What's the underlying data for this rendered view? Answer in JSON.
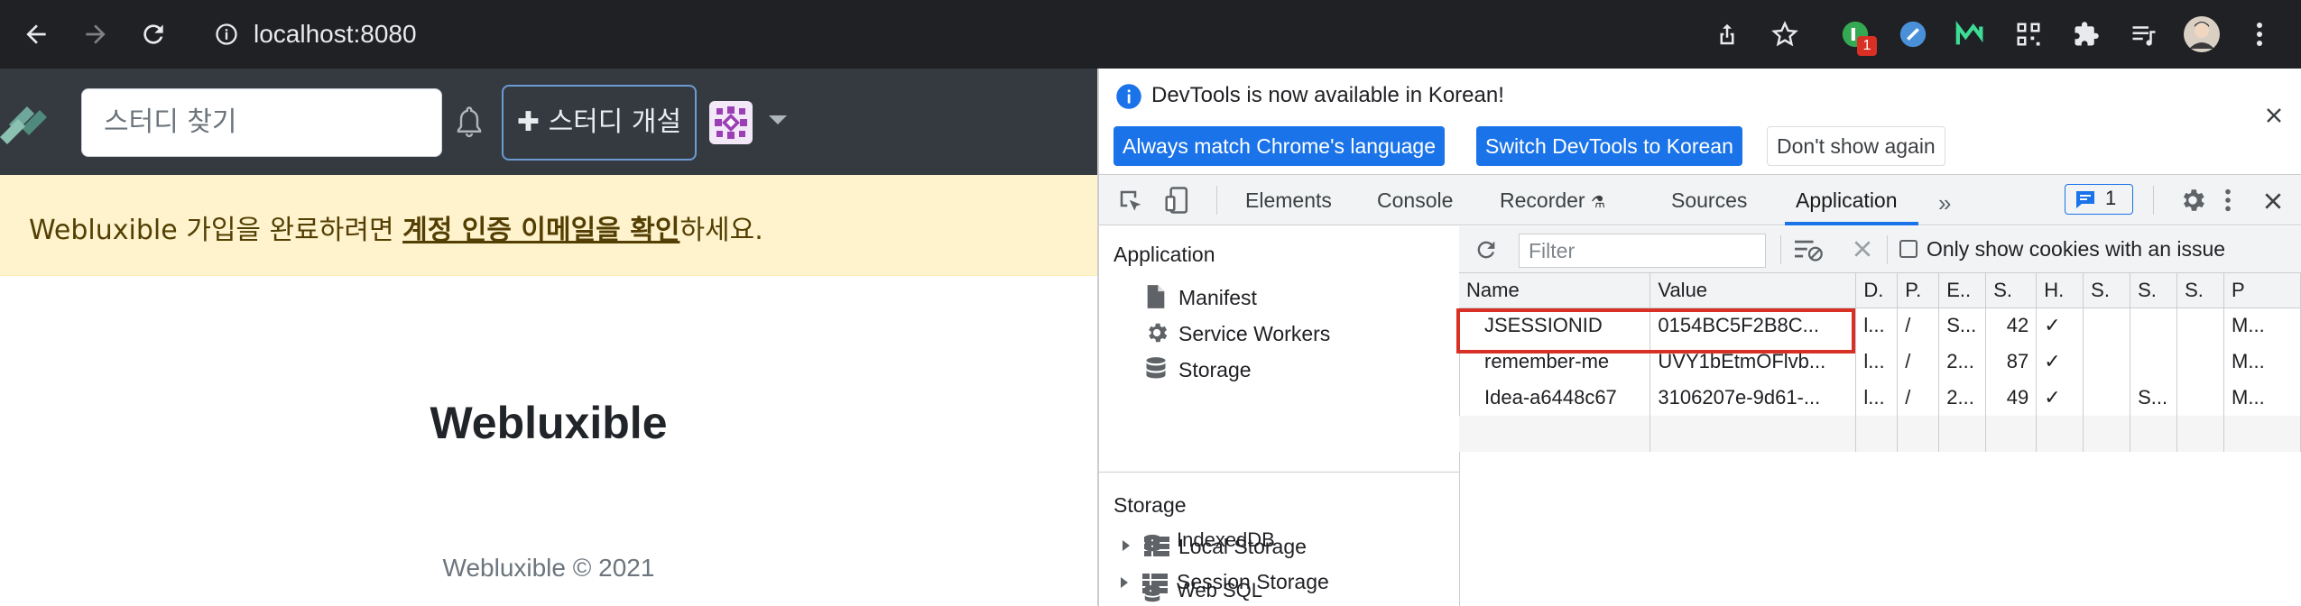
{
  "browser": {
    "url": "localhost:8080",
    "extension_badge": "1",
    "icons": [
      "back-icon",
      "forward-icon",
      "reload-icon",
      "info-icon",
      "share-icon",
      "star-icon",
      "extensions-icon",
      "reading-list-icon",
      "profile-avatar",
      "menu-icon"
    ]
  },
  "page": {
    "search_placeholder": "스터디 찾기",
    "create_study_label": "스터디 개설",
    "alert_prefix": "Webluxible 가입을 완료하려면 ",
    "alert_link": "계정 인증 이메일을 확인",
    "alert_suffix": "하세요.",
    "title": "Webluxible",
    "footer": "Webluxible © 2021"
  },
  "devtools": {
    "info_message": "DevTools is now available in Korean!",
    "buttons": {
      "match_language": "Always match Chrome's language",
      "switch_korean": "Switch DevTools to Korean",
      "dont_show": "Don't show again"
    },
    "tabs": [
      "Elements",
      "Console",
      "Recorder",
      "Sources",
      "Application"
    ],
    "active_tab": "Application",
    "issues_count": "1",
    "sidebar": {
      "application_header": "Application",
      "application_items": [
        "Manifest",
        "Service Workers",
        "Storage"
      ],
      "storage_header": "Storage",
      "storage_items": [
        "Local Storage",
        "Session Storage",
        "IndexedDB",
        "Web SQL"
      ]
    },
    "cookies": {
      "filter_placeholder": "Filter",
      "only_issue_label": "Only show cookies with an issue",
      "columns": [
        "Name",
        "Value",
        "D.",
        "P.",
        "E..",
        "S.",
        "H.",
        "S.",
        "S.",
        "S.",
        "P"
      ],
      "rows": [
        [
          "JSESSIONID",
          "0154BC5F2B8C...",
          "l...",
          "/",
          "S...",
          "42",
          "✓",
          "",
          "",
          "",
          "M..."
        ],
        [
          "remember-me",
          "UVY1bEtmOFlvb...",
          "l...",
          "/",
          "2...",
          "87",
          "✓",
          "",
          "",
          "",
          "M..."
        ],
        [
          "Idea-a6448c67",
          "3106207e-9d61-...",
          "l...",
          "/",
          "2...",
          "49",
          "✓",
          "",
          "S...",
          "",
          "M..."
        ]
      ],
      "highlighted_cookie": "JSESSIONID"
    }
  }
}
